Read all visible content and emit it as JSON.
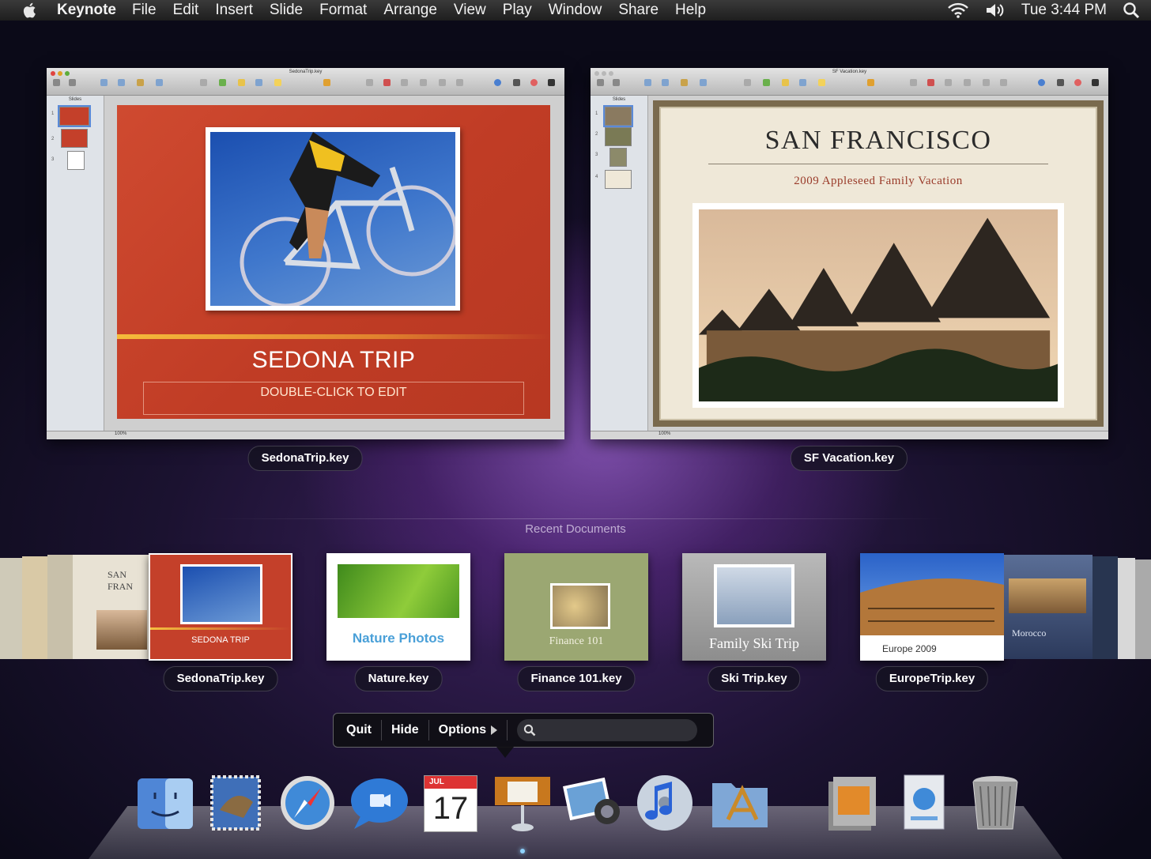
{
  "menubar": {
    "app_name": "Keynote",
    "items": [
      "File",
      "Edit",
      "Insert",
      "Slide",
      "Format",
      "Arrange",
      "View",
      "Play",
      "Window",
      "Share",
      "Help"
    ],
    "clock": "Tue 3:44 PM"
  },
  "windows": [
    {
      "label": "SedonaTrip.key",
      "title": "SedonaTrip.key",
      "slide_title": "SEDONA TRIP",
      "slide_subtitle": "DOUBLE-CLICK TO EDIT",
      "slide_numbers": [
        "1",
        "2",
        "3"
      ],
      "toolbar": [
        "New",
        "Play",
        "View",
        "Guides",
        "Themes",
        "Masters",
        "Text Box",
        "Shapes",
        "Table",
        "Charts",
        "Comment",
        "iWork.com",
        "Mask",
        "Alpha",
        "Group",
        "Ungroup",
        "Front",
        "Back",
        "Inspector",
        "Media",
        "Colors",
        "Fonts"
      ],
      "zoom": "100%"
    },
    {
      "label": "SF Vacation.key",
      "title": "SF Vacation.key",
      "slide_title": "SAN FRANCISCO",
      "slide_subtitle": "2009 Appleseed Family Vacation",
      "slide_numbers": [
        "1",
        "2",
        "3",
        "4"
      ],
      "toolbar": [
        "New",
        "Play",
        "View",
        "Guides",
        "Themes",
        "Masters",
        "Text Box",
        "Shapes",
        "Table",
        "Charts",
        "Comment",
        "iWork.com",
        "Mask",
        "Alpha",
        "Group",
        "Ungroup",
        "Front",
        "Back",
        "Inspector",
        "Media",
        "Colors",
        "Fonts"
      ],
      "zoom": "100%"
    }
  ],
  "recent": {
    "header": "Recent Documents",
    "docs": [
      {
        "label": "SedonaTrip.key",
        "thumb_text": "SEDONA TRIP"
      },
      {
        "label": "Nature.key",
        "thumb_text": "Nature Photos"
      },
      {
        "label": "Finance 101.key",
        "thumb_text": "Finance 101"
      },
      {
        "label": "Ski Trip.key",
        "thumb_text": "Family Ski Trip"
      },
      {
        "label": "EuropeTrip.key",
        "thumb_text": "Europe 2009"
      }
    ],
    "left_stack_text": "SAN FRAN",
    "right_stack_text": "Morocco"
  },
  "hud": {
    "quit": "Quit",
    "hide": "Hide",
    "options": "Options"
  },
  "dock": {
    "calendar_month": "JUL",
    "calendar_day": "17",
    "items": [
      "finder-icon",
      "mail-icon",
      "safari-icon",
      "ichat-icon",
      "ical-icon",
      "keynote-icon",
      "iphoto-icon",
      "itunes-icon",
      "applications-folder-icon",
      "documents-stack-icon",
      "downloads-stack-icon",
      "trash-icon"
    ]
  },
  "colors": {
    "sedona_red": "#c4402a",
    "sf_cream": "#efe8d8",
    "sf_subtitle": "#9a3b2a",
    "desktop_purple": "#3d2160"
  }
}
